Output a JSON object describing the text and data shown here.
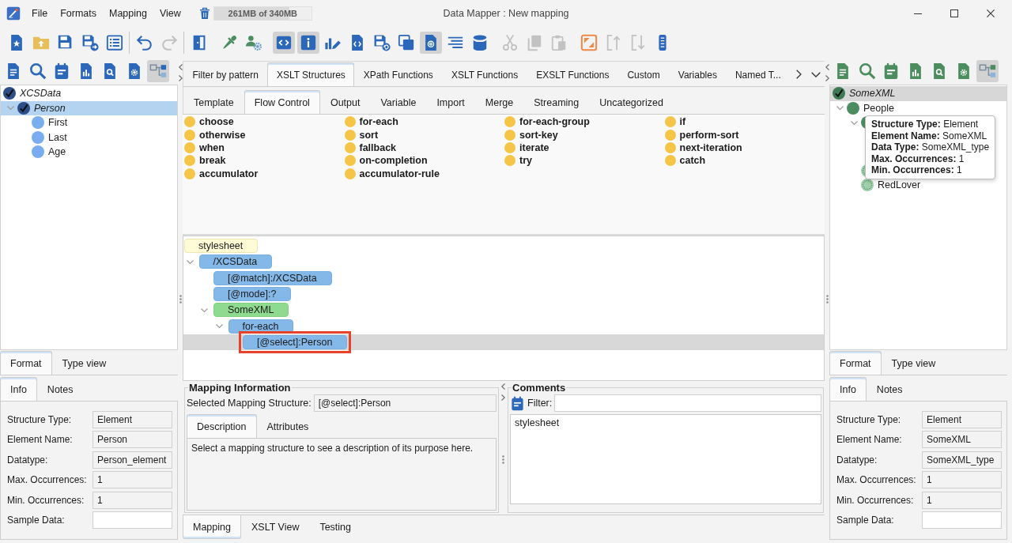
{
  "window": {
    "title": "Data Mapper : New mapping"
  },
  "menu": [
    "File",
    "Formats",
    "Mapping",
    "View"
  ],
  "memory": {
    "label": "261MB of 340MB",
    "level": 0.77
  },
  "toolbar": [
    {
      "divider": true,
      "buttons": [
        {
          "toggled": false,
          "disabled": false
        },
        {
          "toggled": false,
          "disabled": false
        },
        {
          "toggled": false,
          "disabled": false
        },
        {
          "toggled": false,
          "disabled": false
        },
        {
          "toggled": false,
          "disabled": false
        }
      ]
    },
    {
      "divider": true,
      "buttons": [
        {
          "toggled": false,
          "disabled": false
        },
        {
          "toggled": false,
          "disabled": true
        }
      ]
    },
    {
      "divider": false,
      "buttons": [
        {
          "toggled": false,
          "disabled": false
        }
      ]
    },
    {
      "divider": false,
      "buttons": [
        {
          "toggled": false,
          "disabled": false
        },
        {
          "toggled": false,
          "disabled": false
        }
      ]
    },
    {
      "divider": false,
      "buttons": [
        {
          "toggled": true,
          "disabled": false
        },
        {
          "toggled": true,
          "disabled": false
        },
        {
          "toggled": false,
          "disabled": false
        },
        {
          "toggled": false,
          "disabled": false
        },
        {
          "toggled": false,
          "disabled": false
        },
        {
          "toggled": false,
          "disabled": false
        },
        {
          "toggled": true,
          "disabled": false
        },
        {
          "toggled": false,
          "disabled": false
        },
        {
          "toggled": false,
          "disabled": false
        }
      ]
    },
    {
      "divider": false,
      "buttons": [
        {
          "toggled": false,
          "disabled": true
        },
        {
          "toggled": false,
          "disabled": true
        },
        {
          "toggled": false,
          "disabled": true
        }
      ]
    },
    {
      "divider": false,
      "buttons": [
        {
          "toggled": false,
          "disabled": false
        },
        {
          "toggled": false,
          "disabled": true
        },
        {
          "toggled": false,
          "disabled": true
        },
        {
          "toggled": false,
          "disabled": false
        }
      ]
    }
  ],
  "source_panel": {
    "tools": [
      {
        "toggled": false
      },
      {
        "toggled": false
      },
      {
        "toggled": false
      },
      {
        "toggled": false
      },
      {
        "toggled": false
      },
      {
        "toggled": false
      },
      {
        "toggled": true
      }
    ],
    "tree": [
      {
        "label": "XCSData",
        "kind": "check",
        "selected": false,
        "children": [
          {
            "label": "Person",
            "kind": "check",
            "selected": true,
            "expanded": true,
            "children": [
              {
                "label": "First",
                "kind": "dot",
                "selected": false
              },
              {
                "label": "Last",
                "kind": "dot",
                "selected": false
              },
              {
                "label": "Age",
                "kind": "dot",
                "selected": false
              }
            ]
          }
        ]
      }
    ],
    "view_tabs": [
      {
        "label": "Format",
        "selected": true
      },
      {
        "label": "Type view",
        "selected": false
      }
    ],
    "info_tabs": [
      {
        "label": "Info",
        "selected": true
      },
      {
        "label": "Notes",
        "selected": false
      }
    ],
    "fields": [
      {
        "label": "Structure Type:",
        "value": "Element",
        "editable": false
      },
      {
        "label": "Element Name:",
        "value": "Person",
        "editable": false
      },
      {
        "label": "Datatype:",
        "value": "Person_element",
        "editable": false
      },
      {
        "label": "Max. Occurrences:",
        "value": "1",
        "editable": false
      },
      {
        "label": "Min. Occurrences:",
        "value": "1",
        "editable": false
      },
      {
        "label": "Sample Data:",
        "editable": true
      }
    ]
  },
  "library": {
    "tabs": [
      {
        "label": "Filter by pattern",
        "selected": false
      },
      {
        "label": "XSLT Structures",
        "selected": true
      },
      {
        "label": "XPath Functions",
        "selected": false
      },
      {
        "label": "XSLT Functions",
        "selected": false
      },
      {
        "label": "EXSLT Functions",
        "selected": false
      },
      {
        "label": "Custom",
        "selected": false
      },
      {
        "label": "Variables",
        "selected": false
      },
      {
        "label": "Named T...",
        "selected": false
      }
    ],
    "subtabs": [
      {
        "label": "Template",
        "selected": false
      },
      {
        "label": "Flow Control",
        "selected": true
      },
      {
        "label": "Output",
        "selected": false
      },
      {
        "label": "Variable",
        "selected": false
      },
      {
        "label": "Import",
        "selected": false
      },
      {
        "label": "Merge",
        "selected": false
      },
      {
        "label": "Streaming",
        "selected": false
      },
      {
        "label": "Uncategorized",
        "selected": false
      }
    ],
    "items": [
      "choose",
      "for-each",
      "for-each-group",
      "if",
      "otherwise",
      "sort",
      "sort-key",
      "perform-sort",
      "when",
      "fallback",
      "iterate",
      "next-iteration",
      "break",
      "on-completion",
      "try",
      "catch",
      "accumulator",
      "accumulator-rule"
    ]
  },
  "mapping_tree": [
    {
      "label": "stylesheet",
      "kind": "root",
      "selected": false,
      "outlined": false,
      "children": [
        {
          "label": "/XCSData",
          "kind": "xslt",
          "selected": false,
          "outlined": false,
          "expanded": true,
          "children": [
            {
              "label": "[@match]:/XCSData",
              "kind": "xslt",
              "selected": false,
              "outlined": false
            },
            {
              "label": "[@mode]:?",
              "kind": "xslt",
              "selected": false,
              "outlined": false
            },
            {
              "label": "SomeXML",
              "kind": "output",
              "selected": false,
              "outlined": false,
              "expanded": true,
              "children": [
                {
                  "label": "for-each",
                  "kind": "xslt",
                  "selected": false,
                  "outlined": false,
                  "expanded": true,
                  "children": [
                    {
                      "label": "[@select]:Person",
                      "kind": "xslt",
                      "selected": true,
                      "outlined": true
                    }
                  ]
                }
              ]
            }
          ]
        }
      ]
    }
  ],
  "mapping_info": {
    "title": "Mapping Information",
    "selected_label": "Selected Mapping Structure:",
    "selected_value": "[@select]:Person",
    "tabs": [
      {
        "label": "Description",
        "selected": true
      },
      {
        "label": "Attributes",
        "selected": false
      }
    ],
    "description": "Select a mapping structure to see a description of its purpose here."
  },
  "comments": {
    "title": "Comments",
    "filter_label": "Filter:",
    "items": [
      "stylesheet"
    ]
  },
  "bottom_tabs": [
    {
      "label": "Mapping",
      "selected": true
    },
    {
      "label": "XSLT View",
      "selected": false
    },
    {
      "label": "Testing",
      "selected": false
    }
  ],
  "target_panel": {
    "tools": [
      {
        "toggled": false
      },
      {
        "toggled": false
      },
      {
        "toggled": false
      },
      {
        "toggled": false
      },
      {
        "toggled": false
      },
      {
        "toggled": false
      },
      {
        "toggled": true
      }
    ],
    "tree": [
      {
        "label": "SomeXML",
        "kind": "check",
        "selected": true,
        "children": [
          {
            "label": "People",
            "kind": "dot",
            "selected": false,
            "expanded": true,
            "children": [
              {
                "kind": "dot",
                "selected": false,
                "expanded": true
              },
              {
                "kind": "dotted",
                "selected": false
              },
              {
                "label": "RedLover",
                "kind": "dotted",
                "selected": false
              }
            ]
          }
        ]
      }
    ],
    "tooltip": [
      "**Structure Type:** Element",
      "**Element Name:** SomeXML",
      "**Data Type:** SomeXML_type",
      "**Max. Occurrences:** 1",
      "**Min. Occurrences:** 1"
    ],
    "view_tabs": [
      {
        "label": "Format",
        "selected": true
      },
      {
        "label": "Type view",
        "selected": false
      }
    ],
    "info_tabs": [
      {
        "label": "Info",
        "selected": true
      },
      {
        "label": "Notes",
        "selected": false
      }
    ],
    "fields": [
      {
        "label": "Structure Type:",
        "value": "Element",
        "editable": false
      },
      {
        "label": "Element Name:",
        "value": "SomeXML",
        "editable": false
      },
      {
        "label": "Datatype:",
        "value": "SomeXML_type",
        "editable": false
      },
      {
        "label": "Max. Occurrences:",
        "value": "1",
        "editable": false
      },
      {
        "label": "Min. Occurrences:",
        "value": "1",
        "editable": false
      },
      {
        "label": "Sample Data:",
        "editable": true
      }
    ]
  }
}
